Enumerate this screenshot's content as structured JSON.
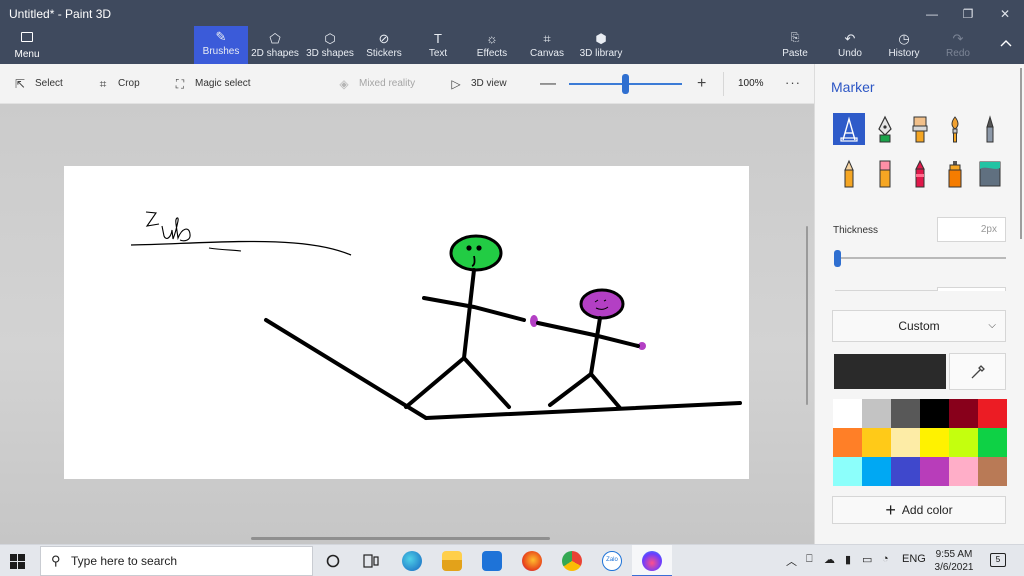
{
  "window": {
    "title": "Untitled* - Paint 3D",
    "controls": {
      "minimize": "—",
      "maximize": "❐",
      "close": "✕"
    }
  },
  "ribbon": {
    "menu_label": "Menu",
    "tools": [
      {
        "label": "Brushes",
        "icon": "brush-icon",
        "glyph": "✎"
      },
      {
        "label": "2D shapes",
        "icon": "shapes-2d-icon",
        "glyph": "⬠"
      },
      {
        "label": "3D shapes",
        "icon": "cube-icon",
        "glyph": "⬡"
      },
      {
        "label": "Stickers",
        "icon": "sticker-icon",
        "glyph": "⊘"
      },
      {
        "label": "Text",
        "icon": "text-icon",
        "glyph": "T"
      },
      {
        "label": "Effects",
        "icon": "sun-icon",
        "glyph": "☼"
      },
      {
        "label": "Canvas",
        "icon": "canvas-icon",
        "glyph": "⌗"
      },
      {
        "label": "3D library",
        "icon": "library-icon",
        "glyph": "⬢"
      }
    ],
    "right": [
      {
        "label": "Paste",
        "icon": "paste-icon",
        "glyph": "📋"
      },
      {
        "label": "Undo",
        "icon": "undo-icon",
        "glyph": "↶"
      },
      {
        "label": "History",
        "icon": "history-icon",
        "glyph": "◷"
      },
      {
        "label": "Redo",
        "icon": "redo-icon",
        "glyph": "↷"
      }
    ],
    "collapse_icon": "chevron-up-icon"
  },
  "subbar": {
    "select_label": "Select",
    "crop_label": "Crop",
    "magic_select_label": "Magic select",
    "mixed_reality_label": "Mixed reality",
    "view3d_label": "3D view",
    "zoom_minus": "—",
    "zoom_plus": "+",
    "zoom_value": 52,
    "zoom_pct": "100%",
    "more": "···"
  },
  "panel": {
    "title": "Marker",
    "brushes": [
      "marker",
      "calligraphy-pen",
      "oil-brush",
      "watercolor",
      "pixel-pen",
      "pencil",
      "eraser",
      "crayon",
      "spray-can",
      "fill"
    ],
    "thickness_label": "Thickness",
    "thickness_value": "2px",
    "thickness_level": 0.0,
    "texture_dropdown": "Custom",
    "current_color": "#2a2a2a",
    "palette": [
      "#ffffff",
      "#c3c3c3",
      "#585858",
      "#000000",
      "#88001b",
      "#ec1c24",
      "#ff7f27",
      "#ffca18",
      "#fdeca6",
      "#fff200",
      "#c4ff0e",
      "#0ed145",
      "#8cfffb",
      "#00a8f3",
      "#3f48cc",
      "#b83dba",
      "#ffaec8",
      "#b97a56"
    ],
    "add_color_label": "Add color"
  },
  "drawing": {
    "scribble_text": "ZUb",
    "colors": {
      "stroke": "#000000",
      "green_head": "#22cc44",
      "purple": "#b33fc4"
    }
  },
  "taskbar": {
    "search_placeholder": "Type here to search",
    "apps": [
      "task-view-icon",
      "edge-icon",
      "file-explorer-icon",
      "mail-icon",
      "firefox-icon",
      "chrome-icon",
      "zalo-icon",
      "paint3d-icon"
    ],
    "zalo_label": "Zalo",
    "language": "ENG",
    "time": "9:55 AM",
    "date": "3/6/2021",
    "notifications": "5"
  },
  "accent": "#3b5bd9"
}
